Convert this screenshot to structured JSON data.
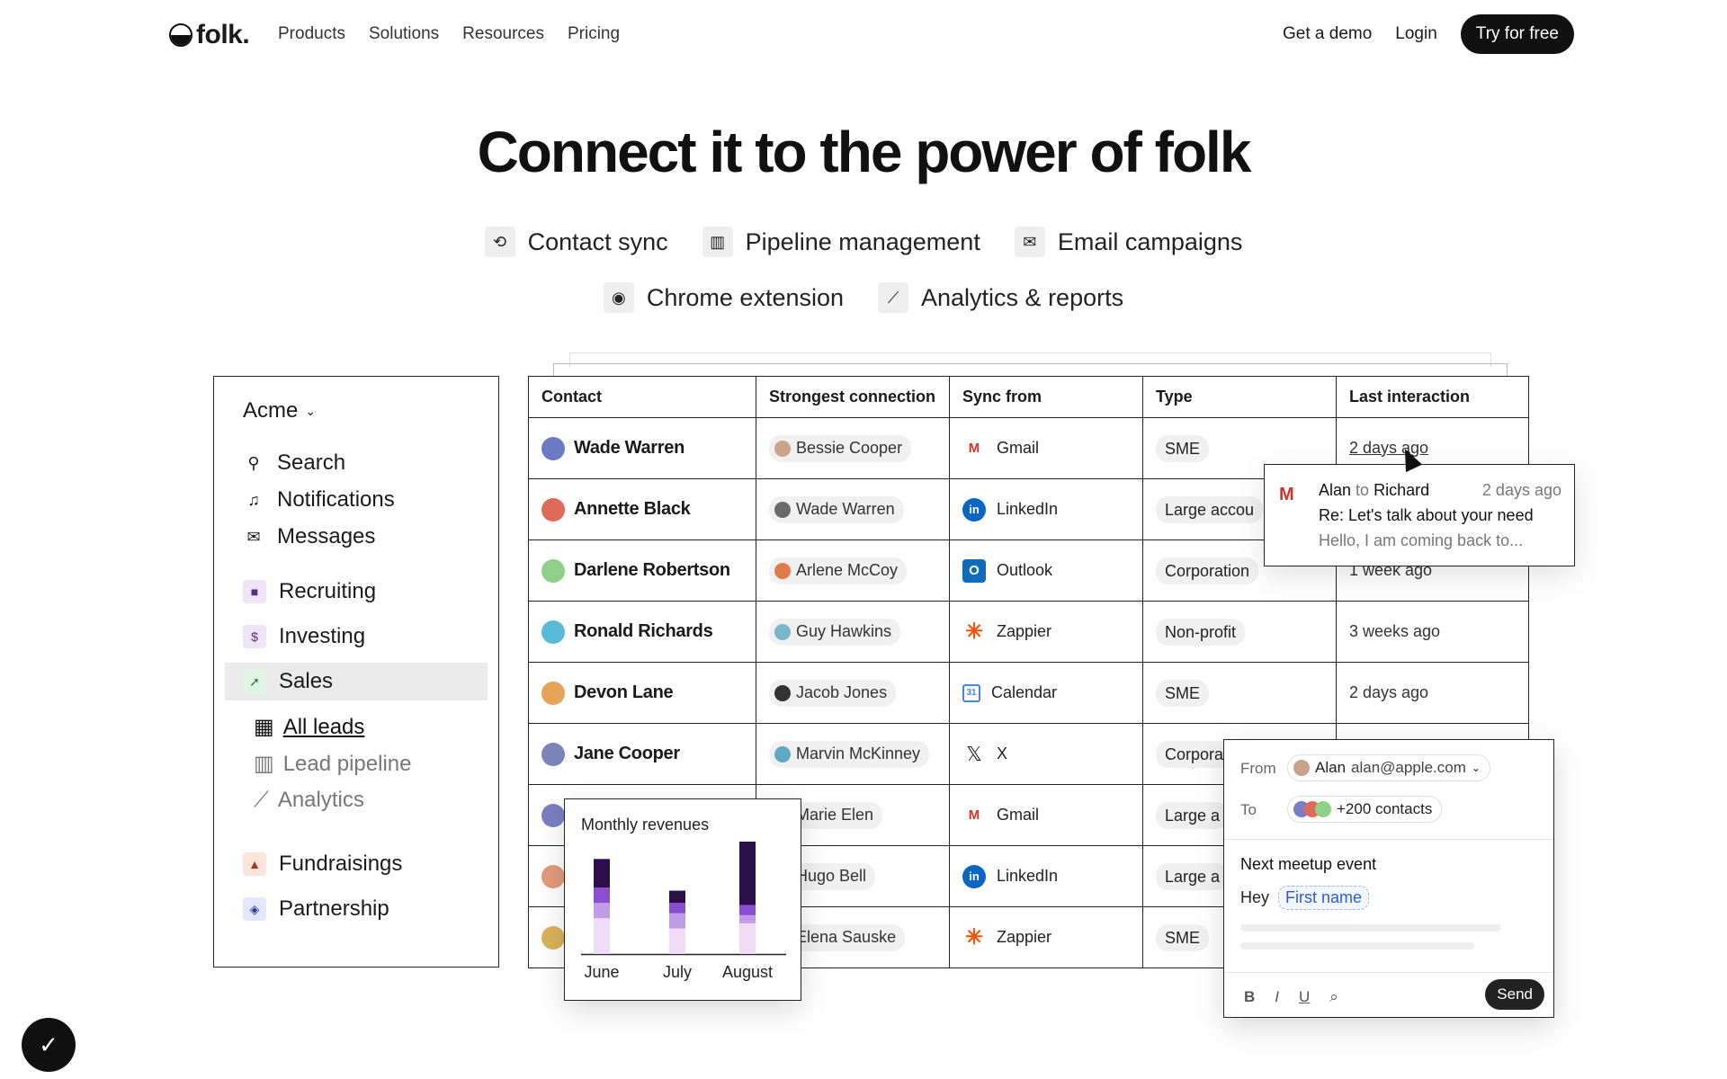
{
  "nav": {
    "logo_text": "folk.",
    "links": [
      "Products",
      "Solutions",
      "Resources",
      "Pricing"
    ],
    "get_demo": "Get a demo",
    "login": "Login",
    "try_free": "Try for free"
  },
  "hero": {
    "title": "Connect it to the power of folk",
    "features": [
      {
        "label": "Contact sync",
        "icon": "sync-icon"
      },
      {
        "label": "Pipeline management",
        "icon": "pipeline-icon"
      },
      {
        "label": "Email campaigns",
        "icon": "mail-icon"
      },
      {
        "label": "Chrome extension",
        "icon": "chrome-icon"
      },
      {
        "label": "Analytics & reports",
        "icon": "analytics-icon"
      }
    ]
  },
  "sidebar": {
    "workspace": "Acme",
    "items": [
      {
        "label": "Search",
        "icon": "search-icon"
      },
      {
        "label": "Notifications",
        "icon": "bell-icon"
      },
      {
        "label": "Messages",
        "icon": "envelope-icon"
      },
      {
        "label": "Recruiting",
        "icon": "briefcase-icon"
      },
      {
        "label": "Investing",
        "icon": "dollar-icon"
      },
      {
        "label": "Sales",
        "icon": "rocket-icon"
      },
      {
        "label": "Fundraisings",
        "icon": "chart-icon"
      },
      {
        "label": "Partnership",
        "icon": "handshake-icon"
      }
    ],
    "sub_items": [
      {
        "label": "All leads",
        "icon": "table-icon"
      },
      {
        "label": "Lead pipeline",
        "icon": "pipeline-icon"
      },
      {
        "label": "Analytics",
        "icon": "analytics-icon"
      }
    ]
  },
  "table": {
    "headers": [
      "Contact",
      "Strongest connection",
      "Sync from",
      "Type",
      "Last interaction"
    ],
    "rows": [
      {
        "contact": "Wade Warren",
        "connection": "Bessie Cooper",
        "sync": "Gmail",
        "type": "SME",
        "last": "2 days ago"
      },
      {
        "contact": "Annette Black",
        "connection": "Wade Warren",
        "sync": "LinkedIn",
        "type": "Large accou",
        "last": ""
      },
      {
        "contact": "Darlene Robertson",
        "connection": "Arlene McCoy",
        "sync": "Outlook",
        "type": "Corporation",
        "last": "1 week ago"
      },
      {
        "contact": "Ronald Richards",
        "connection": "Guy Hawkins",
        "sync": "Zappier",
        "type": "Non-profit",
        "last": "3 weeks ago"
      },
      {
        "contact": "Devon Lane",
        "connection": "Jacob Jones",
        "sync": "Calendar",
        "type": "SME",
        "last": "2 days ago"
      },
      {
        "contact": "Jane Cooper",
        "connection": "Marvin McKinney",
        "sync": "X",
        "type": "Corpora",
        "last": ""
      },
      {
        "contact": "",
        "connection": "Marie Elen",
        "sync": "Gmail",
        "type": "Large a",
        "last": ""
      },
      {
        "contact": "",
        "connection": "Hugo Bell",
        "sync": "LinkedIn",
        "type": "Large a",
        "last": ""
      },
      {
        "contact": "",
        "connection": "Elena Sauske",
        "sync": "Zappier",
        "type": "SME",
        "last": ""
      }
    ]
  },
  "email_popup": {
    "from": "Alan",
    "to_word": "to",
    "to": "Richard",
    "time": "2 days ago",
    "subject": "Re: Let's talk about your need",
    "preview": "Hello, I am coming back to..."
  },
  "chart_popup": {
    "title": "Monthly revenues"
  },
  "chart_data": {
    "type": "bar",
    "title": "Monthly revenues",
    "categories": [
      "June",
      "July",
      "August"
    ],
    "series": [
      {
        "values": [
          35,
          25,
          30
        ]
      },
      {
        "values": [
          15,
          15,
          8
        ]
      },
      {
        "values": [
          15,
          10,
          10
        ]
      },
      {
        "values": [
          28,
          12,
          62
        ]
      }
    ],
    "colors": [
      "#f0dcf7",
      "#c39ce6",
      "#8a4fcf",
      "#2a0f4a"
    ],
    "stacked": true,
    "grid": false
  },
  "compose": {
    "from_label": "From",
    "from_name": "Alan",
    "from_email": "alan@apple.com",
    "to_label": "To",
    "to_value": "+200 contacts",
    "subject": "Next meetup event",
    "greeting": "Hey",
    "variable": "First name",
    "tools": [
      "B",
      "I",
      "U"
    ],
    "send": "Send"
  },
  "colors": {
    "accent": "#111111",
    "gmail": "#d93025",
    "linkedin": "#0a66c2",
    "outlook": "#0f6cbd",
    "zappier": "#ff4f00"
  }
}
